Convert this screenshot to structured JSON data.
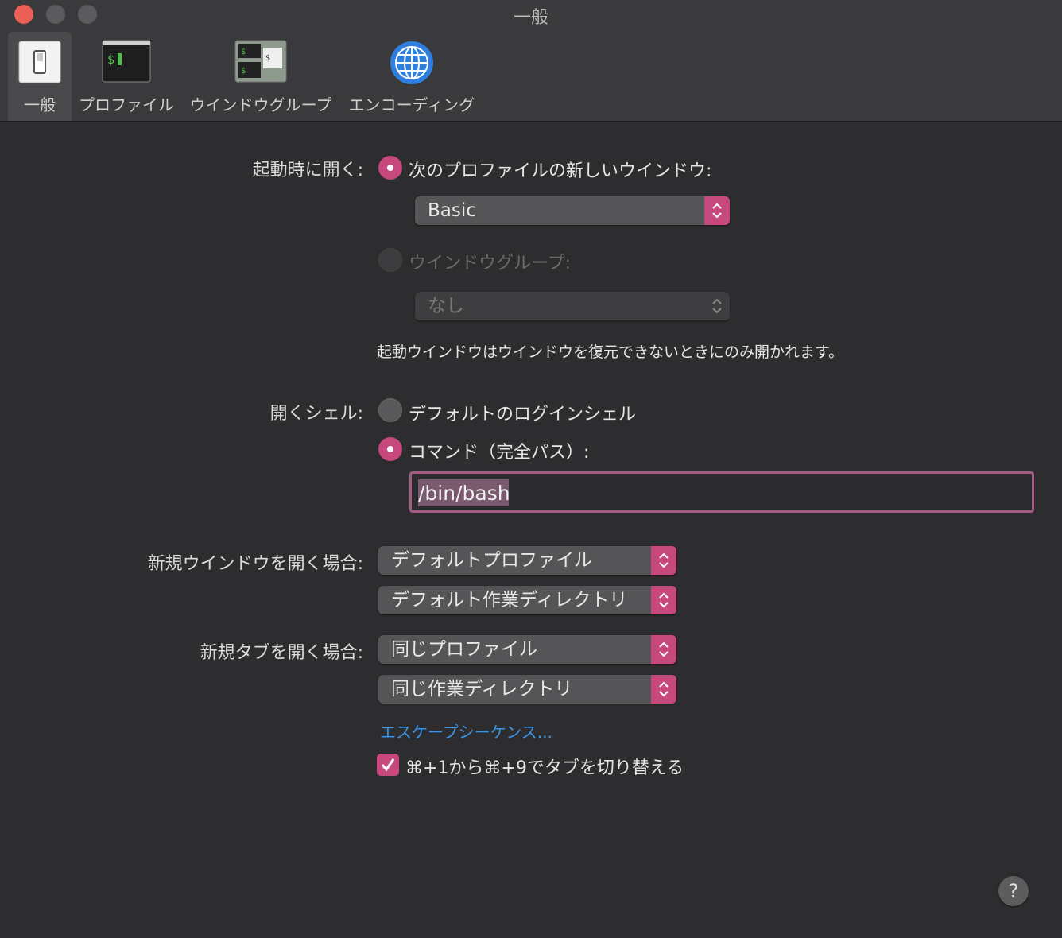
{
  "window": {
    "title": "一般"
  },
  "toolbar": {
    "items": [
      {
        "label": "一般",
        "icon": "switch-icon",
        "selected": true
      },
      {
        "label": "プロファイル",
        "icon": "terminal-icon",
        "selected": false
      },
      {
        "label": "ウインドウグループ",
        "icon": "window-group-icon",
        "selected": false
      },
      {
        "label": "エンコーディング",
        "icon": "globe-icon",
        "selected": false
      }
    ]
  },
  "startup": {
    "label": "起動時に開く:",
    "option_profile": "次のプロファイルの新しいウインドウ:",
    "profile_value": "Basic",
    "option_group": "ウインドウグループ:",
    "group_value": "なし",
    "note": "起動ウインドウはウインドウを復元できないときにのみ開かれます。"
  },
  "shell": {
    "label": "開くシェル:",
    "option_default": "デフォルトのログインシェル",
    "option_command": "コマンド（完全パス）:",
    "command_value": "/bin/bash"
  },
  "new_window": {
    "label": "新規ウインドウを開く場合:",
    "profile": "デフォルトプロファイル",
    "directory": "デフォルト作業ディレクトリ"
  },
  "new_tab": {
    "label": "新規タブを開く場合:",
    "profile": "同じプロファイル",
    "directory": "同じ作業ディレクトリ"
  },
  "escape_link": "エスケープシーケンス...",
  "tab_switch": {
    "label": "⌘+1から⌘+9でタブを切り替える",
    "checked": true
  },
  "help": "?",
  "colors": {
    "accent": "#c7487c",
    "link": "#3a95e8",
    "background": "#2d2d2f"
  }
}
